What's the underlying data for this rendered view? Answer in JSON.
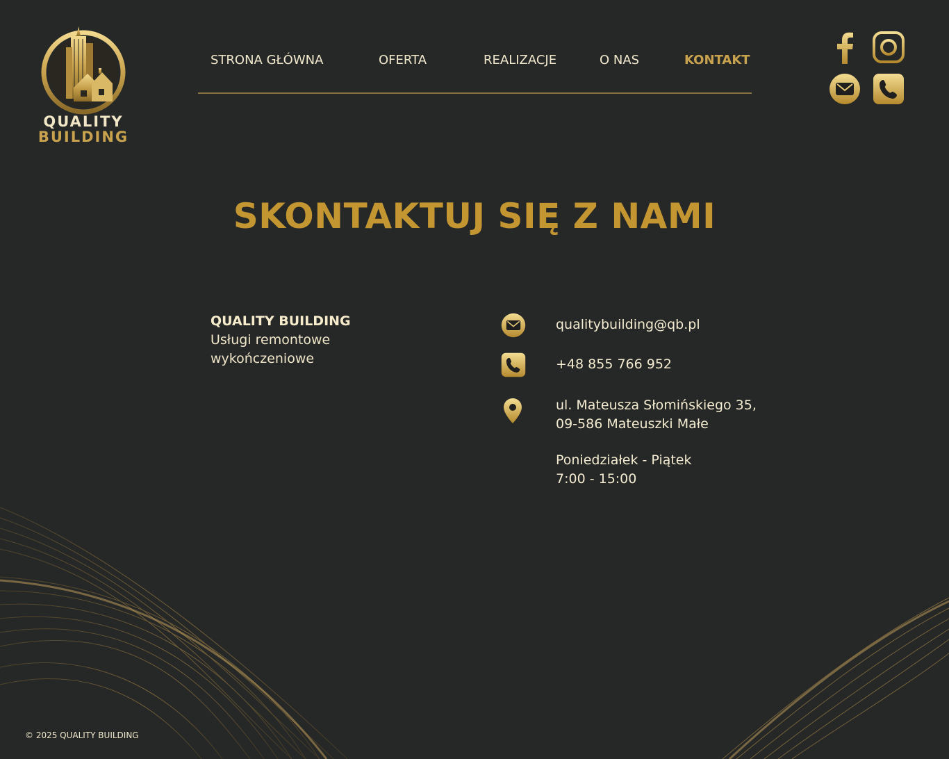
{
  "logo": {
    "line1": "QUALITY",
    "line2": "BUILDING"
  },
  "nav": {
    "items": [
      {
        "label": "STRONA GŁÓWNA",
        "active": false
      },
      {
        "label": "OFERTA",
        "active": false
      },
      {
        "label": "REALIZACJE",
        "active": false
      },
      {
        "label": "O NAS",
        "active": false
      },
      {
        "label": "KONTAKT",
        "active": true
      }
    ]
  },
  "social": [
    "facebook-icon",
    "instagram-icon",
    "mail-icon",
    "phone-icon"
  ],
  "page_title": "SKONTAKTUJ SIĘ Z NAMI",
  "company": {
    "name": "QUALITY BUILDING",
    "desc_line1": "Usługi remontowe",
    "desc_line2": "wykończeniowe"
  },
  "contact": {
    "email": "qualitybuilding@qb.pl",
    "phone": "+48 855 766 952",
    "address_line1": "ul. Mateusza Słomińskiego 35,",
    "address_line2": "09-586 Mateuszki Małe",
    "hours_days": "Poniedziałek - Piątek",
    "hours_time": "7:00 - 15:00"
  },
  "footer": "© 2025 QUALITY BUILDING",
  "colors": {
    "background": "#262727",
    "gold": "#c39632",
    "text": "#f4ecd0"
  }
}
